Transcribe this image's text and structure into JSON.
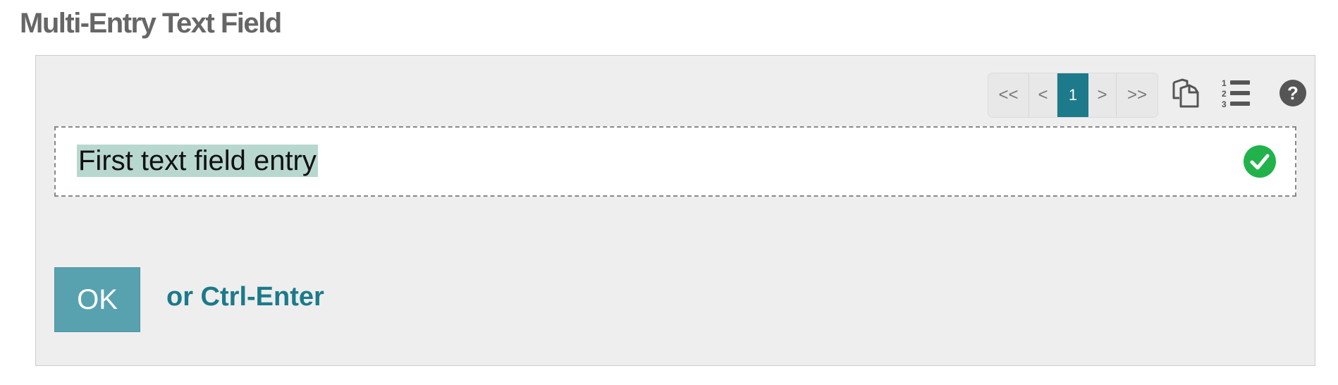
{
  "title": "Multi-Entry Text Field",
  "pager": {
    "first": "<<",
    "prev": "<",
    "current": "1",
    "next": ">",
    "last": ">>"
  },
  "icons": {
    "copy": "copy-icon",
    "list": "numbered-list-icon",
    "help": "help-icon",
    "check": "check-circle-icon"
  },
  "entry": {
    "value": "First text field entry"
  },
  "actions": {
    "ok_label": "OK",
    "hint": "or Ctrl-Enter"
  },
  "colors": {
    "accent": "#1c7a8a",
    "ok_button": "#58a2b0",
    "selection": "#b8d8cf",
    "check": "#22b24c",
    "panel": "#eeeeee",
    "title": "#666666"
  }
}
